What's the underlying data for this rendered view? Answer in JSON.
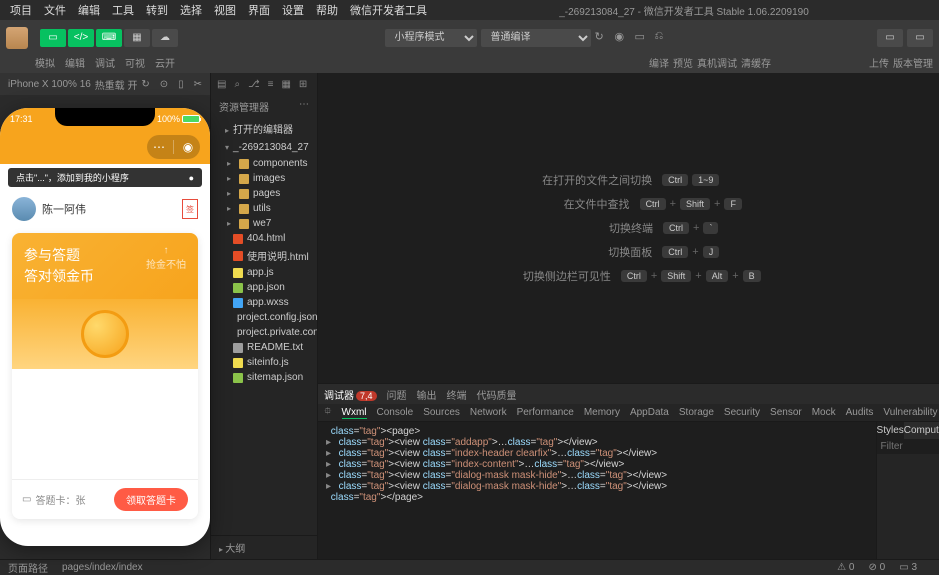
{
  "menu": [
    "项目",
    "文件",
    "编辑",
    "工具",
    "转到",
    "选择",
    "视图",
    "界面",
    "设置",
    "帮助",
    "微信开发者工具"
  ],
  "window_title": "_-269213084_27 - 微信开发者工具 Stable 1.06.2209190",
  "toolbar": {
    "mode_select": "小程序模式",
    "compile_select": "普通编译",
    "sublabels": [
      "模拟器",
      "编辑器",
      "调试器",
      "可视化",
      "云开发"
    ],
    "right_sublabels": [
      "编译",
      "预览",
      "真机调试",
      "清缓存"
    ],
    "far_right": [
      "上传",
      "版本管理"
    ]
  },
  "simulator": {
    "device": "iPhone X 100% 16",
    "wifi": "热重载 开",
    "statusbar_time": "17:31",
    "battery_pct": "100%",
    "tip_text": "点击\"...\"，添加到我的小程序",
    "user_name": "陈一阿伟",
    "card_line1": "参与答题",
    "card_line2": "答对领金币",
    "card_right_sub": "抢金不怕",
    "arrow": "↑",
    "footer_left": "答题卡：张",
    "footer_btn": "领取答题卡"
  },
  "explorer": {
    "title": "资源管理器",
    "section_open": "打开的编辑器",
    "project_name": "_-269213084_27",
    "folders": [
      "components",
      "images",
      "pages",
      "utils",
      "we7"
    ],
    "files": [
      {
        "name": "404.html",
        "type": "html"
      },
      {
        "name": "使用说明.html",
        "type": "html"
      },
      {
        "name": "app.js",
        "type": "js"
      },
      {
        "name": "app.json",
        "type": "json"
      },
      {
        "name": "app.wxss",
        "type": "wxss"
      },
      {
        "name": "project.config.json",
        "type": "json"
      },
      {
        "name": "project.private.config.js...",
        "type": "json"
      },
      {
        "name": "README.txt",
        "type": "txt"
      },
      {
        "name": "siteinfo.js",
        "type": "js"
      },
      {
        "name": "sitemap.json",
        "type": "json"
      }
    ],
    "outline": "大纲"
  },
  "editor_hints": [
    {
      "label": "在打开的文件之间切换",
      "keys": [
        "Ctrl",
        "1~9"
      ]
    },
    {
      "label": "在文件中查找",
      "keys": [
        "Ctrl",
        "+",
        "Shift",
        "+",
        "F"
      ]
    },
    {
      "label": "切换终端",
      "keys": [
        "Ctrl",
        "+",
        "`"
      ]
    },
    {
      "label": "切换面板",
      "keys": [
        "Ctrl",
        "+",
        "J"
      ]
    },
    {
      "label": "切换侧边栏可见性",
      "keys": [
        "Ctrl",
        "+",
        "Shift",
        "+",
        "Alt",
        "+",
        "B"
      ]
    }
  ],
  "devtools": {
    "tabs1": [
      {
        "label": "调试器",
        "badge": "7,4"
      },
      {
        "label": "问题"
      },
      {
        "label": "输出"
      },
      {
        "label": "终端"
      },
      {
        "label": "代码质量"
      }
    ],
    "tabs2": [
      "Wxml",
      "Console",
      "Sources",
      "Network",
      "Performance",
      "Memory",
      "AppData",
      "Storage",
      "Security",
      "Sensor",
      "Mock",
      "Audits",
      "Vulnerability"
    ],
    "side_tabs": [
      "Styles",
      "Computed"
    ],
    "filter_placeholder": "Filter",
    "code": [
      {
        "indent": 0,
        "tri": "",
        "text": "<page>"
      },
      {
        "indent": 1,
        "tri": "▸",
        "text": "<view class=\"addapp\">…</view>"
      },
      {
        "indent": 1,
        "tri": "▸",
        "text": "<view class=\"index-header clearfix\">…</view>"
      },
      {
        "indent": 1,
        "tri": "▸",
        "text": "<view class=\"index-content\">…</view>"
      },
      {
        "indent": 1,
        "tri": "▸",
        "text": "<view class=\"dialog-mask mask-hide\">…</view>"
      },
      {
        "indent": 1,
        "tri": "▸",
        "text": "<view class=\"dialog-mask mask-hide\">…</view>"
      },
      {
        "indent": 0,
        "tri": "",
        "text": "</page>"
      }
    ]
  },
  "statusbar": {
    "left1": "页面路径",
    "left2": "pages/index/index",
    "warns": "0",
    "errs": "0",
    "scene": "3"
  }
}
